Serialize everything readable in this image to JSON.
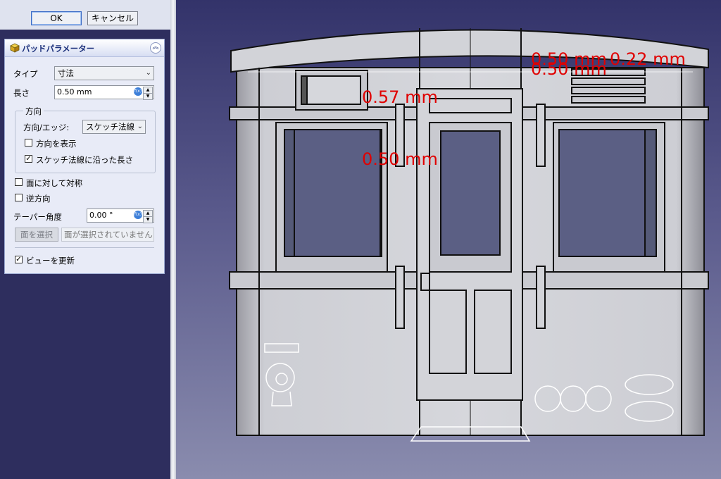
{
  "dialog": {
    "ok_label": "OK",
    "cancel_label": "キャンセル"
  },
  "panel": {
    "title": "パッドパラメーター",
    "type_label": "タイプ",
    "type_value": "寸法",
    "length_label": "長さ",
    "length_value": "0.50 mm",
    "direction_group": "方向",
    "direction_edge_label": "方向/エッジ:",
    "direction_edge_value": "スケッチ法線",
    "show_direction_label": "方向を表示",
    "show_direction_checked": false,
    "length_along_normal_label": "スケッチ法線に沿った長さ",
    "length_along_normal_checked": true,
    "symmetric_label": "面に対して対称",
    "symmetric_checked": false,
    "reversed_label": "逆方向",
    "reversed_checked": false,
    "taper_label": "テーパー角度",
    "taper_value": "0.00 °",
    "select_face_label": "面を選択",
    "face_placeholder": "面が選択されていません",
    "update_view_label": "ビューを更新",
    "update_view_checked": true
  },
  "viewport": {
    "dimensions": [
      "0.50 mm",
      "0.22 mm",
      "0.50 mm",
      "0.57 mm",
      "0.50 mm"
    ]
  },
  "icons": {
    "panel_icon": "pad-icon",
    "collapse": "collapse-icon",
    "expression": "fx-icon"
  },
  "colors": {
    "dimension": "#e00000",
    "view_top": "#33336a",
    "view_bottom": "#8a8cae"
  }
}
